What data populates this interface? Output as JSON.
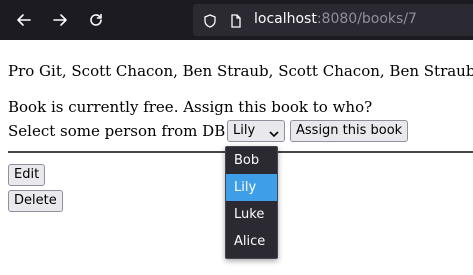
{
  "browser": {
    "url_host": "localhost",
    "url_rest": ":8080/books/7"
  },
  "page": {
    "book_title": "Pro Git, Scott Chacon, Ben Straub, Scott Chacon, Ben Straub",
    "status_text": "Book is currently free. Assign this book to who?",
    "select_label": "Select some person from DB",
    "selected_person": "Lily",
    "assign_button": "Assign this book",
    "edit_button": "Edit",
    "delete_button": "Delete"
  },
  "dropdown": {
    "options": [
      "Bob",
      "Lily",
      "Luke",
      "Alice"
    ],
    "selected": "Lily"
  },
  "colors": {
    "toolbar_bg": "#1c1b22",
    "urlbar_bg": "#2b2a33",
    "dropdown_bg": "#2b2a33",
    "highlight": "#3f9ee8"
  }
}
